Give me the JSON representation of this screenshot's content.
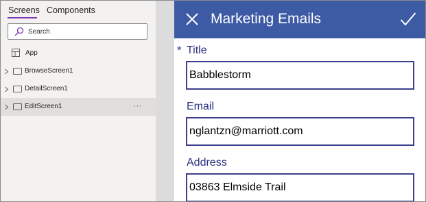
{
  "tree_panel": {
    "tabs": [
      {
        "label": "Screens",
        "active": true
      },
      {
        "label": "Components",
        "active": false
      }
    ],
    "search": {
      "placeholder": "Search",
      "value": ""
    },
    "items": [
      {
        "label": "App",
        "icon": "app-icon",
        "expandable": false,
        "selected": false
      },
      {
        "label": "BrowseScreen1",
        "icon": "screen-icon",
        "expandable": true,
        "selected": false
      },
      {
        "label": "DetailScreen1",
        "icon": "screen-icon",
        "expandable": true,
        "selected": false
      },
      {
        "label": "EditScreen1",
        "icon": "screen-icon",
        "expandable": true,
        "selected": true,
        "more": "···"
      }
    ],
    "accent_color": "#7d39b9"
  },
  "form": {
    "header": {
      "title": "Marketing Emails",
      "background": "#3d5aa5",
      "close_icon": "close-icon",
      "submit_icon": "check-icon"
    },
    "required_mark": "*",
    "fields": [
      {
        "label": "Title",
        "value": "Babblestorm",
        "required": true
      },
      {
        "label": "Email",
        "value": "nglantzn@marriott.com",
        "required": false
      },
      {
        "label": "Address",
        "value": "03863 Elmside Trail",
        "required": false
      }
    ],
    "text_color": "#2a2f7f"
  }
}
